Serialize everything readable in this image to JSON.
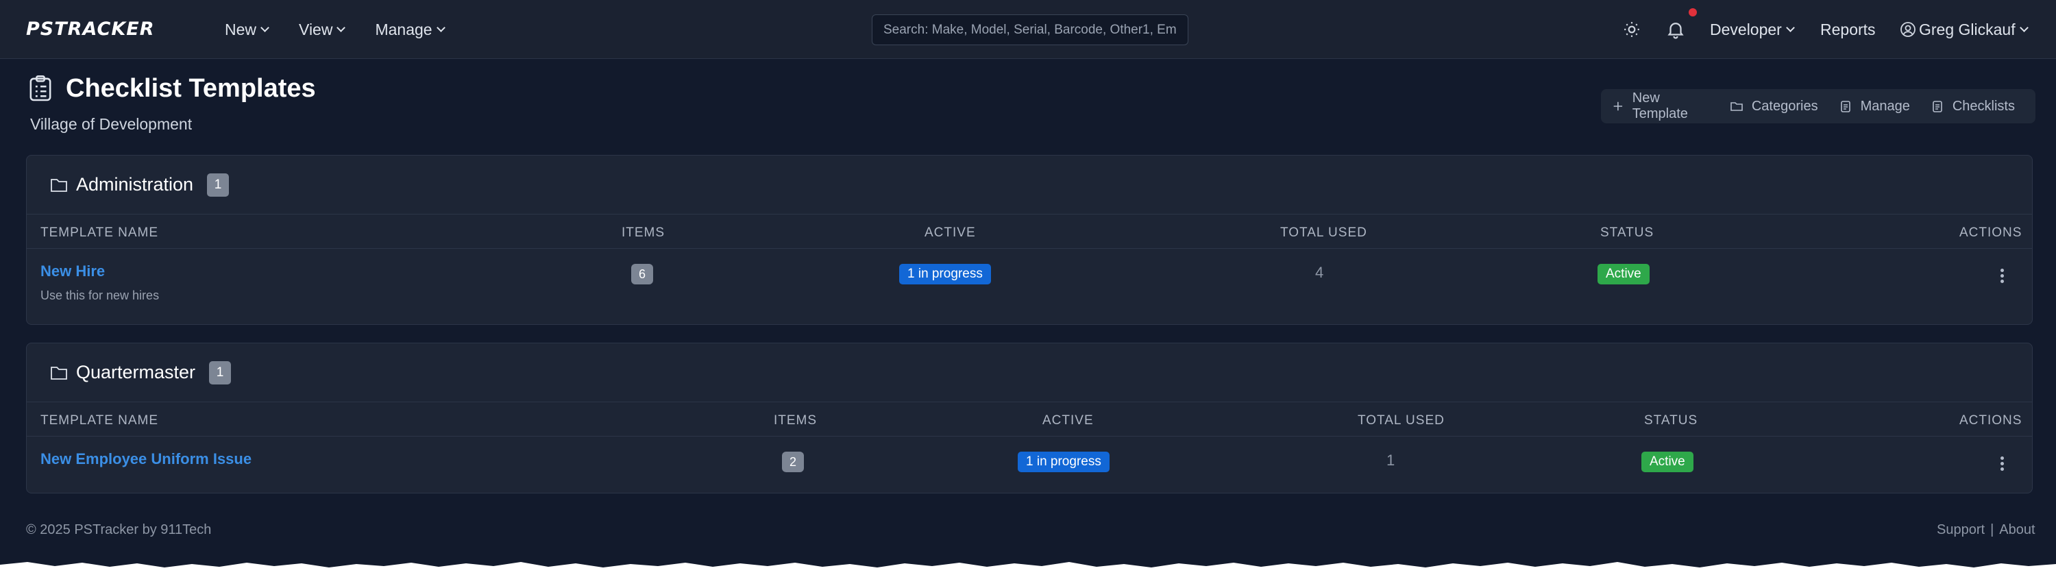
{
  "navbar": {
    "brand": "PSTRACKER",
    "menu": [
      "New",
      "View",
      "Manage"
    ],
    "search_placeholder": "Search: Make, Model, Serial, Barcode, Other1, Em",
    "developer": "Developer",
    "reports": "Reports",
    "user": "Greg Glickauf"
  },
  "header": {
    "title": "Checklist Templates",
    "subtitle": "Village of Development",
    "toolbar": {
      "new_template": "New Template",
      "categories": "Categories",
      "manage": "Manage",
      "checklists": "Checklists"
    }
  },
  "columns": {
    "template_name": "TEMPLATE NAME",
    "items": "ITEMS",
    "active": "ACTIVE",
    "total_used": "TOTAL USED",
    "status": "STATUS",
    "actions": "ACTIONS"
  },
  "groups": [
    {
      "name": "Administration",
      "count": "1",
      "rows": [
        {
          "name": "New Hire",
          "description": "Use this for new hires",
          "items": "6",
          "active": "1 in progress",
          "total_used": "4",
          "status": "Active"
        }
      ]
    },
    {
      "name": "Quartermaster",
      "count": "1",
      "rows": [
        {
          "name": "New Employee Uniform Issue",
          "items": "2",
          "active": "1 in progress",
          "total_used": "1",
          "status": "Active"
        }
      ]
    }
  ],
  "footer": {
    "copyright": "© 2025  PSTracker by 911Tech",
    "support": "Support",
    "separator": "|",
    "about": "About"
  },
  "colors": {
    "background": "#121a2c",
    "navbar": "#1b2231",
    "card": "#1d2535",
    "link": "#3b8fe6",
    "progress": "#1267d6",
    "active": "#2ea84a",
    "notification_dot": "#e0313b"
  },
  "icons": [
    "sun-icon",
    "bell-icon",
    "user-icon",
    "clipboard-icon",
    "folder-icon",
    "plus-icon",
    "kebab-icon"
  ]
}
